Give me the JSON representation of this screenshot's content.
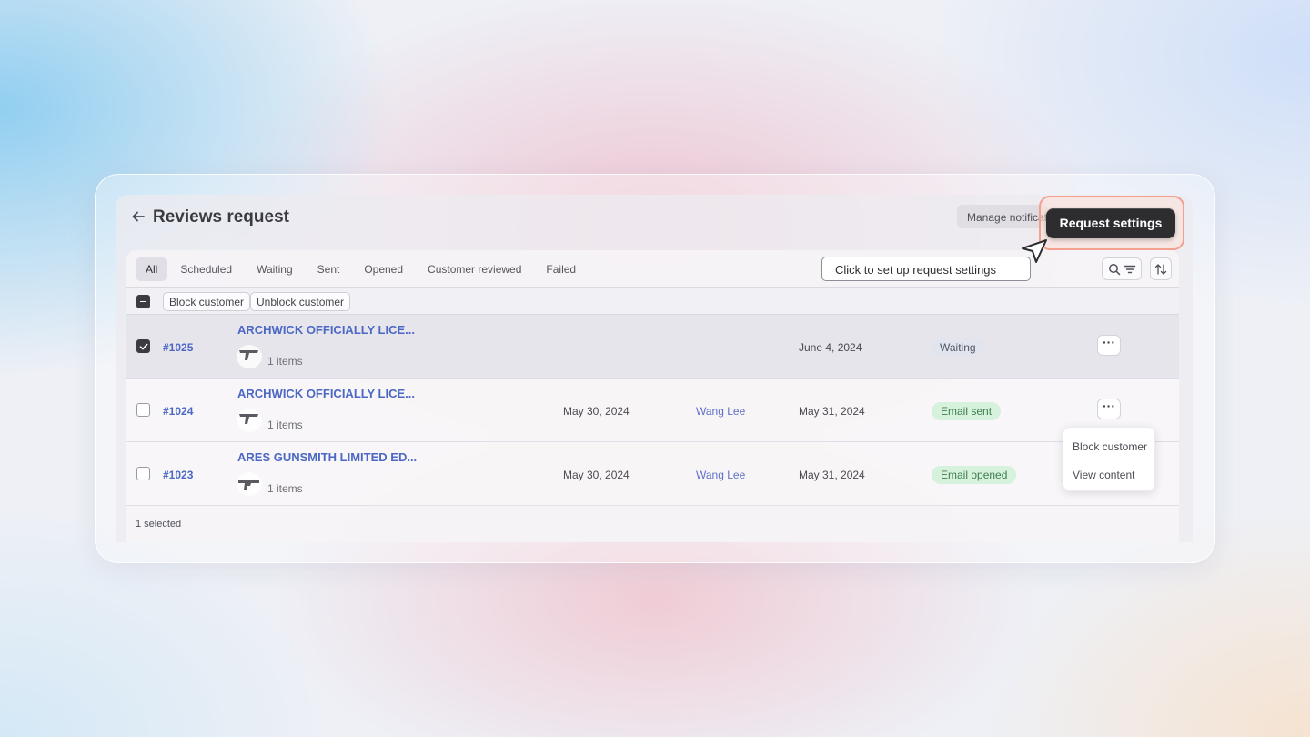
{
  "header": {
    "title": "Reviews request",
    "manage_label": "Manage notifications",
    "request_settings_label": "Request settings"
  },
  "tabs": [
    {
      "label": "All"
    },
    {
      "label": "Scheduled"
    },
    {
      "label": "Waiting"
    },
    {
      "label": "Sent"
    },
    {
      "label": "Opened"
    },
    {
      "label": "Customer reviewed"
    },
    {
      "label": "Failed"
    }
  ],
  "bulk_actions": {
    "block_label": "Block customer",
    "unblock_label": "Unblock customer"
  },
  "rows": [
    {
      "order": "#1025",
      "product": "ARCHWICK OFFICIALLY LICE...",
      "items": "1 items",
      "created": "",
      "customer": "",
      "date": "June 4, 2024",
      "status": "Waiting",
      "selected": true
    },
    {
      "order": "#1024",
      "product": "ARCHWICK OFFICIALLY LICE...",
      "items": "1 items",
      "created": "May 30, 2024",
      "customer": "Wang Lee",
      "date": "May 31, 2024",
      "status": "Email sent",
      "selected": false
    },
    {
      "order": "#1023",
      "product": "ARES GUNSMITH LIMITED ED...",
      "items": "1 items",
      "created": "May 30, 2024",
      "customer": "Wang Lee",
      "date": "May 31, 2024",
      "status": "Email opened",
      "selected": false
    }
  ],
  "row_menu": {
    "block_label": "Block customer",
    "view_label": "View content"
  },
  "footer": {
    "selected_text": "1 selected"
  },
  "tooltip": {
    "text": "Click to set up request settings"
  },
  "icons": {
    "back": "arrow-left-icon",
    "search": "search-icon",
    "filter": "filter-lines-icon",
    "sort": "sort-arrows-icon",
    "more": "more-dots-icon",
    "cursor": "pointer-cursor-icon",
    "product": "product-thumbnail-icon"
  },
  "colors": {
    "link": "#4c68c4",
    "primary_button": "#2d2d30",
    "highlight": "#f3a08e",
    "badge_green_bg": "#d4f0da",
    "badge_grey_bg": "#e2e4ee"
  }
}
